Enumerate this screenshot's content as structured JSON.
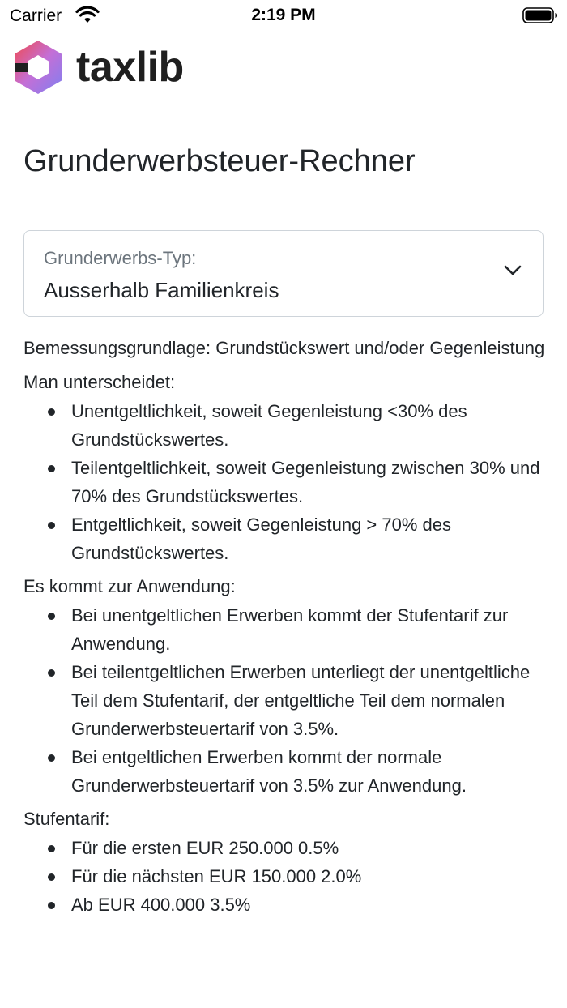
{
  "status_bar": {
    "carrier": "Carrier",
    "time": "2:19 PM"
  },
  "app": {
    "logo_text": "taxlib",
    "logo_colors": {
      "red": "#e5484d",
      "purple": "#9b7fe6",
      "dark": "#1f1f1f"
    }
  },
  "page": {
    "title": "Grunderwerbsteuer-Rechner"
  },
  "select": {
    "label": "Grunderwerbs-Typ:",
    "value": "Ausserhalb Familienkreis",
    "icon": "chevron-down-icon"
  },
  "content": {
    "basis": "Bemessungsgrundlage: Grundstückswert und/oder Gegenleistung",
    "distinguish_heading": "Man unterscheidet:",
    "distinguish_items": [
      "Unentgeltlichkeit, soweit Gegenleistung <30% des Grundstückswertes.",
      "Teilentgeltlichkeit, soweit Gegenleistung zwischen 30% und 70% des Grundstückswertes.",
      "Entgeltlichkeit, soweit Gegenleistung > 70% des Grundstückswertes."
    ],
    "application_heading": "Es kommt zur Anwendung:",
    "application_items": [
      "Bei unentgeltlichen Erwerben kommt der Stufentarif zur Anwendung.",
      "Bei teilentgeltlichen Erwerben unterliegt der unentgeltliche Teil dem Stufentarif, der entgeltliche Teil dem normalen Grunderwerbsteuertarif von 3.5%.",
      "Bei entgeltlichen Erwerben kommt der normale Grunderwerbsteuertarif von 3.5% zur Anwendung."
    ],
    "tariff_heading": "Stufentarif:",
    "tariff_items": [
      "Für die ersten EUR 250.000 0.5%",
      "Für die nächsten EUR 150.000 2.0%",
      "Ab EUR 400.000 3.5%"
    ]
  }
}
